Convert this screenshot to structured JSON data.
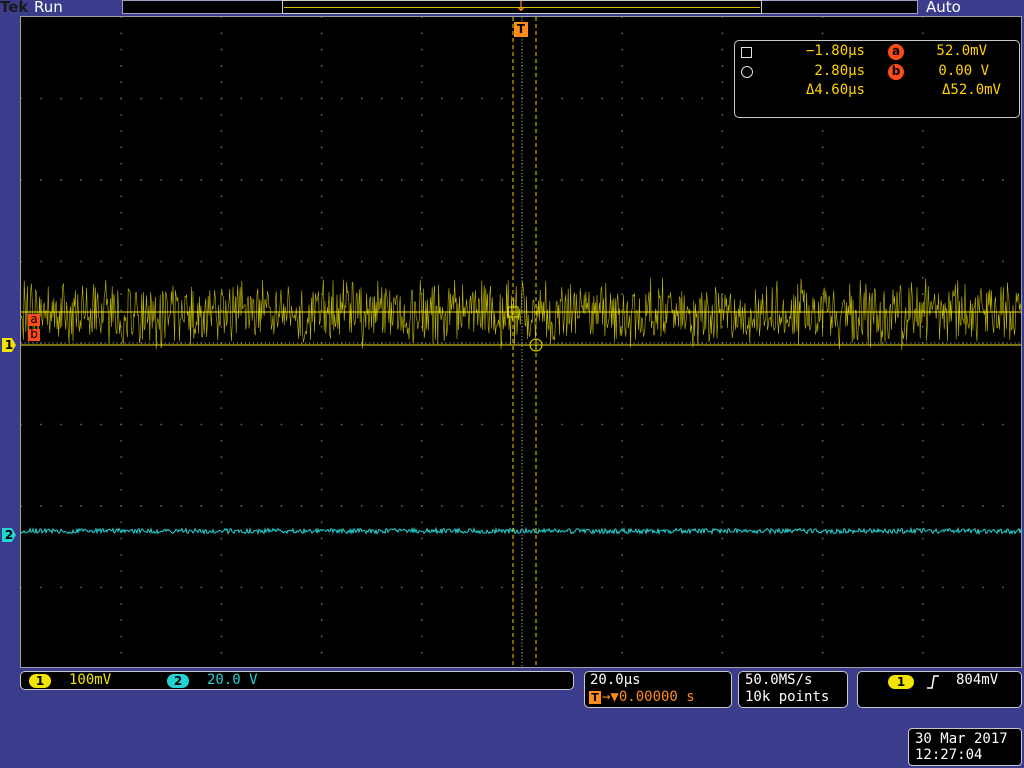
{
  "topbar": {
    "brand": "Tek",
    "state": "Run",
    "trigger_mode": "Auto"
  },
  "trigger_marker": {
    "label": "T",
    "arrow": "↓"
  },
  "cursor_readout": {
    "time_a": "−1.80µs",
    "time_b": "2.80µs",
    "delta_time": "Δ4.60µs",
    "label_a": "a",
    "label_b": "b",
    "volt_a": "52.0mV",
    "volt_b": "0.00 V",
    "delta_volt": "Δ52.0mV"
  },
  "markers": {
    "cursor_a": "a",
    "cursor_b": "b",
    "channel_1": "1",
    "channel_2": "2"
  },
  "channels": [
    {
      "id": "1",
      "scale": "100mV",
      "color": "#f0e400"
    },
    {
      "id": "2",
      "scale": "20.0 V",
      "color": "#22d3d3"
    }
  ],
  "timebase": {
    "scale": "20.0µs",
    "trigger_pos_label": "T",
    "position": "→▼0.00000 s"
  },
  "acquisition": {
    "sample_rate": "50.0MS/s",
    "record_length": "10k points"
  },
  "trigger": {
    "source": "1",
    "slope_icon": "rising-edge",
    "level": "804mV"
  },
  "datetime": {
    "date": "30 Mar  2017",
    "time": "12:27:04"
  },
  "colors": {
    "ch1": "#f0e400",
    "ch2": "#22d3d3",
    "cursor": "#ff4a1a",
    "trigger": "#ff8c1a",
    "bezel": "#3b3d8c"
  }
}
